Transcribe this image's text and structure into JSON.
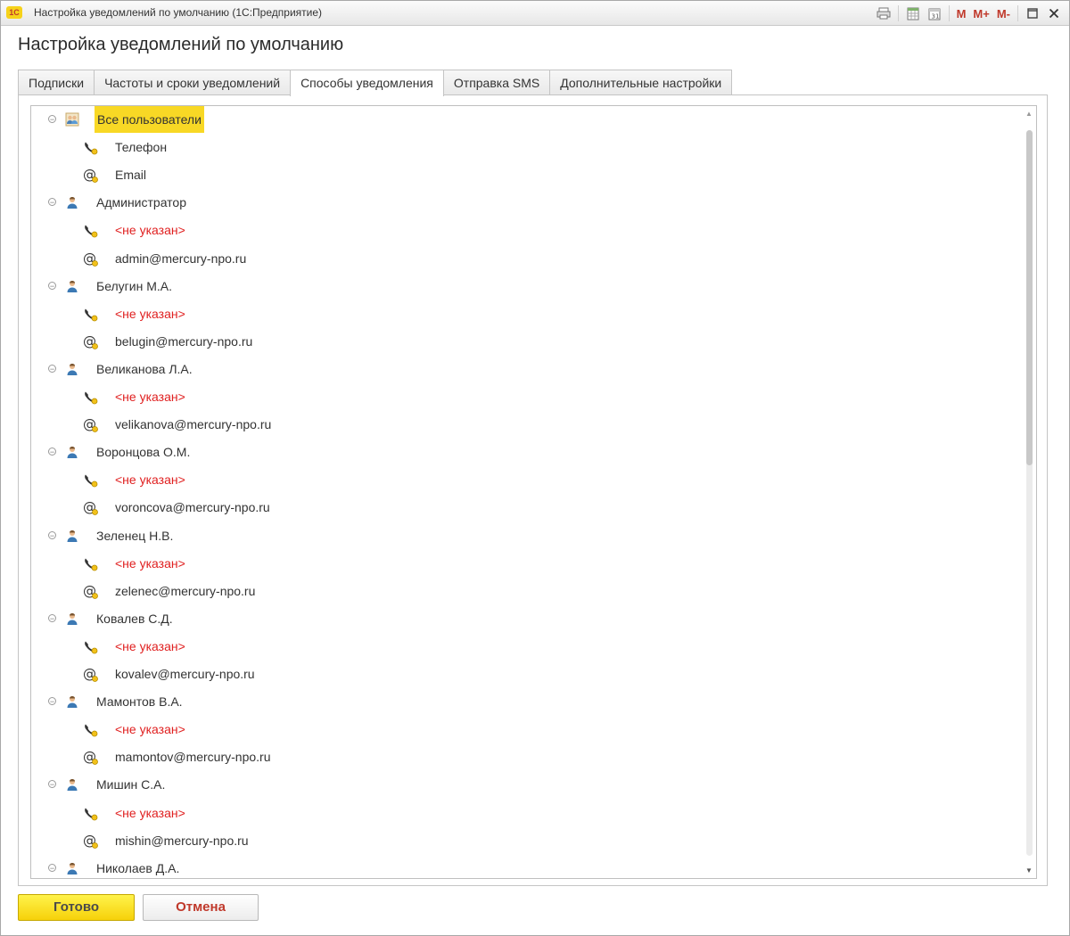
{
  "window": {
    "title": "Настройка уведомлений по умолчанию  (1С:Предприятие)",
    "logo": "1С"
  },
  "titlebar_icons": [
    "print-icon",
    "spreadsheet-icon",
    "calendar-icon",
    "M",
    "M+",
    "M-",
    "maximize-icon",
    "close-icon"
  ],
  "heading": "Настройка уведомлений по умолчанию",
  "tabs": [
    {
      "label": "Подписки"
    },
    {
      "label": "Частоты и сроки уведомлений"
    },
    {
      "label": "Способы уведомления",
      "active": true
    },
    {
      "label": "Отправка SMS"
    },
    {
      "label": "Дополнительные настройки"
    }
  ],
  "tree": [
    {
      "label": "Все пользователи",
      "icon": "users-group-icon",
      "highlighted": true,
      "children": [
        {
          "icon": "phone-icon",
          "label": "Телефон"
        },
        {
          "icon": "email-icon",
          "label": "Email"
        }
      ]
    },
    {
      "label": "Администратор",
      "icon": "user-icon",
      "children": [
        {
          "icon": "phone-icon",
          "label": "<не указан>",
          "missing": true
        },
        {
          "icon": "email-icon",
          "label": "admin@mercury-npo.ru"
        }
      ]
    },
    {
      "label": "Белугин М.А.",
      "icon": "user-icon",
      "children": [
        {
          "icon": "phone-icon",
          "label": "<не указан>",
          "missing": true
        },
        {
          "icon": "email-icon",
          "label": "belugin@mercury-npo.ru"
        }
      ]
    },
    {
      "label": "Великанова Л.А.",
      "icon": "user-icon",
      "children": [
        {
          "icon": "phone-icon",
          "label": "<не указан>",
          "missing": true
        },
        {
          "icon": "email-icon",
          "label": "velikanova@mercury-npo.ru"
        }
      ]
    },
    {
      "label": "Воронцова О.М.",
      "icon": "user-icon",
      "children": [
        {
          "icon": "phone-icon",
          "label": "<не указан>",
          "missing": true
        },
        {
          "icon": "email-icon",
          "label": "voroncova@mercury-npo.ru"
        }
      ]
    },
    {
      "label": "Зеленец Н.В.",
      "icon": "user-icon",
      "children": [
        {
          "icon": "phone-icon",
          "label": "<не указан>",
          "missing": true
        },
        {
          "icon": "email-icon",
          "label": "zelenec@mercury-npo.ru"
        }
      ]
    },
    {
      "label": "Ковалев С.Д.",
      "icon": "user-icon",
      "children": [
        {
          "icon": "phone-icon",
          "label": "<не указан>",
          "missing": true
        },
        {
          "icon": "email-icon",
          "label": "kovalev@mercury-npo.ru"
        }
      ]
    },
    {
      "label": "Мамонтов В.А.",
      "icon": "user-icon",
      "children": [
        {
          "icon": "phone-icon",
          "label": "<не указан>",
          "missing": true
        },
        {
          "icon": "email-icon",
          "label": "mamontov@mercury-npo.ru"
        }
      ]
    },
    {
      "label": "Мишин С.А.",
      "icon": "user-icon",
      "children": [
        {
          "icon": "phone-icon",
          "label": "<не указан>",
          "missing": true
        },
        {
          "icon": "email-icon",
          "label": "mishin@mercury-npo.ru"
        }
      ]
    },
    {
      "label": "Николаев Д.А.",
      "icon": "user-icon",
      "children": []
    }
  ],
  "buttons": {
    "done": "Готово",
    "cancel": "Отмена"
  },
  "colors": {
    "accent_yellow": "#f8d825",
    "missing_red": "#e02020",
    "brand_red": "#c0392b"
  }
}
